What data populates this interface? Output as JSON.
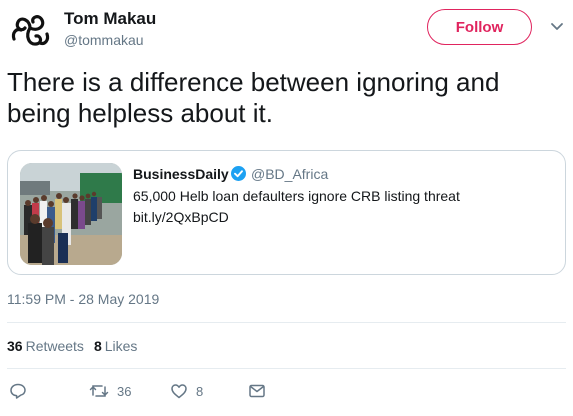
{
  "author": {
    "name": "Tom Makau",
    "handle": "@tommakau",
    "avatar_icon": "triskelion-icon"
  },
  "follow_button": {
    "label": "Follow",
    "color": "#e0245e"
  },
  "tweet": {
    "text": "There is a difference between ignoring and being helpless about it."
  },
  "quoted": {
    "name": "BusinessDaily",
    "verified_icon": "verified-badge-icon",
    "handle": "@BD_Africa",
    "text": "65,000 Helb loan defaulters ignore CRB listing threat",
    "link": "bit.ly/2QxBpCD",
    "image_icon": "queue-photo-thumbnail"
  },
  "timestamp": "11:59 PM - 28 May 2019",
  "stats": {
    "retweets_count": "36",
    "retweets_label": "Retweets",
    "likes_count": "8",
    "likes_label": "Likes"
  },
  "actions": {
    "reply_icon": "reply-icon",
    "retweet_icon": "retweet-icon",
    "retweet_count": "36",
    "like_icon": "heart-icon",
    "like_count": "8",
    "message_icon": "envelope-icon"
  },
  "colors": {
    "text": "#14171a",
    "secondary": "#657786",
    "border": "#ccd6dd",
    "verified": "#1da1f2"
  }
}
